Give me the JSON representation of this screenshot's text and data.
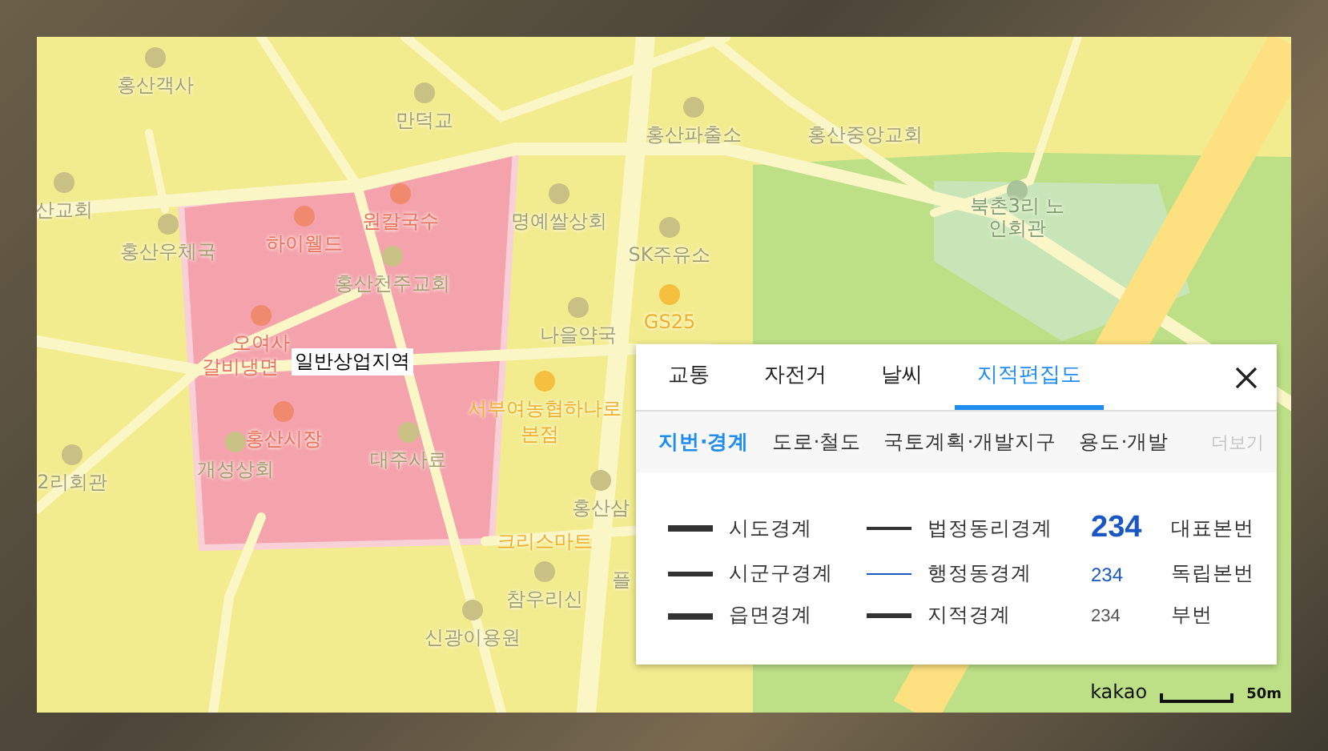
{
  "map": {
    "places": [
      {
        "text": "홍산객사",
        "kind": "place"
      },
      {
        "text": "만덕교",
        "kind": "place"
      },
      {
        "text": "산교회",
        "kind": "place"
      },
      {
        "text": "홍산우체국",
        "kind": "place"
      },
      {
        "text": "하이웰드",
        "kind": "restaurant"
      },
      {
        "text": "원칼국수",
        "kind": "restaurant"
      },
      {
        "text": "홍산천주교회",
        "kind": "place"
      },
      {
        "text": "명예쌀상회",
        "kind": "place"
      },
      {
        "text": "SK주유소",
        "kind": "place"
      },
      {
        "text": "GS25",
        "kind": "store"
      },
      {
        "text": "나을약국",
        "kind": "place"
      },
      {
        "text": "홍산파출소",
        "kind": "place"
      },
      {
        "text": "홍산중앙교회",
        "kind": "place"
      },
      {
        "text": "북촌3리 노인회관",
        "kind": "park"
      },
      {
        "text": "오여사",
        "kind": "restaurant"
      },
      {
        "text": "갈비냉면",
        "kind": "restaurant"
      },
      {
        "text": "홍산시장",
        "kind": "restaurant"
      },
      {
        "text": "개성상회",
        "kind": "place"
      },
      {
        "text": "대주사료",
        "kind": "place"
      },
      {
        "text": "서부여농협하나로",
        "kind": "store"
      },
      {
        "text": "본점",
        "kind": "store"
      },
      {
        "text": "2리회관",
        "kind": "place"
      },
      {
        "text": "홍산삼",
        "kind": "place"
      },
      {
        "text": "크리스마트",
        "kind": "store"
      },
      {
        "text": "참우리신",
        "kind": "place"
      },
      {
        "text": "신광이용원",
        "kind": "place"
      },
      {
        "text": "플",
        "kind": "place"
      }
    ],
    "zone_label": "일반상업지역",
    "logo": "kakao",
    "scale": "50m"
  },
  "panel": {
    "tabs": [
      {
        "label": "교통",
        "selected": false
      },
      {
        "label": "자전거",
        "selected": false
      },
      {
        "label": "날씨",
        "selected": false
      },
      {
        "label": "지적편집도",
        "selected": true
      }
    ],
    "subtabs": [
      {
        "label": "지번·경계",
        "selected": true
      },
      {
        "label": "도로·철도",
        "selected": false
      },
      {
        "label": "국토계획·개발지구",
        "selected": false
      },
      {
        "label": "용도·개발",
        "selected": false
      }
    ],
    "more": "더보기",
    "legend": [
      {
        "kind": "line",
        "color": "#333333",
        "label": "시도경계"
      },
      {
        "kind": "line",
        "color": "#333333",
        "label": "법정동리경계"
      },
      {
        "kind": "number",
        "color": "#1a56c4",
        "sample": "234",
        "label": "대표본번"
      },
      {
        "kind": "line",
        "color": "#333333",
        "label": "시군구경계"
      },
      {
        "kind": "line",
        "color": "#1a56c4",
        "label": "행정동경계"
      },
      {
        "kind": "number",
        "color": "#1a56c4",
        "sample": "234",
        "label": "독립본번"
      },
      {
        "kind": "line",
        "color": "#333333",
        "label": "읍면경계"
      },
      {
        "kind": "line",
        "color": "#333333",
        "label": "지적경계"
      },
      {
        "kind": "number",
        "color": "#555555",
        "sample": "234",
        "label": "부번"
      }
    ]
  }
}
